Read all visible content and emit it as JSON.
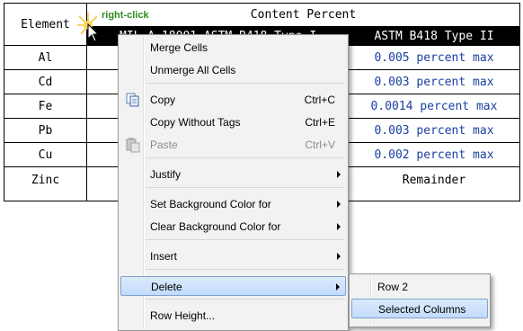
{
  "table": {
    "header_element": "Element",
    "header_content": "Content Percent",
    "col2_header": "MIL-A-18001 ASTM B418 Type I",
    "col3_header": "ASTM B418 Type II",
    "rows": [
      {
        "element": "Al",
        "value": "0.005 percent max"
      },
      {
        "element": "Cd",
        "value": "0.003 percent max"
      },
      {
        "element": "Fe",
        "value": "0.0014 percent max"
      },
      {
        "element": "Pb",
        "value": "0.003 percent max"
      },
      {
        "element": "Cu",
        "value": "0.002 percent max"
      },
      {
        "element": "Zinc",
        "value": "Remainder"
      }
    ]
  },
  "annotation": {
    "label": "right-click"
  },
  "context_menu": {
    "merge_cells": "Merge Cells",
    "unmerge_all": "Unmerge All Cells",
    "copy": "Copy",
    "copy_shortcut": "Ctrl+C",
    "copy_without_tags": "Copy Without Tags",
    "copy_without_tags_shortcut": "Ctrl+E",
    "paste": "Paste",
    "paste_shortcut": "Ctrl+V",
    "justify": "Justify",
    "set_bg": "Set Background Color for",
    "clear_bg": "Clear Background Color for",
    "insert": "Insert",
    "delete": "Delete",
    "row_height": "Row Height..."
  },
  "submenu": {
    "row2": "Row 2",
    "selected_columns": "Selected Columns"
  },
  "colors": {
    "menu_bg": "#f2f2f2",
    "hover_bg": "#c1dbfc",
    "hover_border": "#7da2ce",
    "header_dark": "#000000",
    "value_blue": "#1a3fa0",
    "annotation_green": "#2e8b1e"
  }
}
